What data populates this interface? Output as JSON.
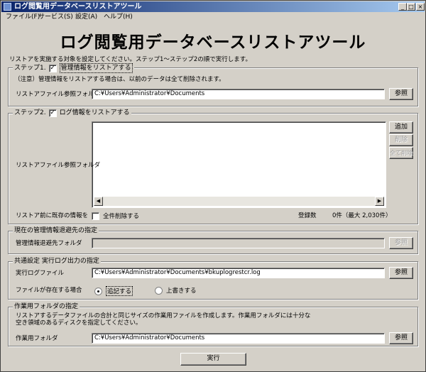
{
  "window": {
    "title": "ログ閲覧用データベースリストアツール"
  },
  "menu": [
    "ファイル(F)",
    "サービス(S)",
    "設定(A)",
    "ヘルプ(H)"
  ],
  "header": {
    "title": "ログ閲覧用データベースリストアツール",
    "intro": "リストアを実施する対象を設定してください。ステップ1～ステップ2の順で実行します。"
  },
  "step1": {
    "legend": "ステップ1.",
    "checkbox_label": "管理情報をリストアする",
    "checked": true,
    "note": "（注意）管理情報をリストアする場合は、以前のデータは全て削除されます。",
    "folder_label": "リストアファイル参照フォルダ",
    "folder_value": "C:¥Users¥Administrator¥Documents",
    "browse_label": "参照"
  },
  "step2": {
    "legend": "ステップ2.",
    "checkbox_label": "ログ情報をリストアする",
    "checked": true,
    "folder_label": "リストアファイル参照フォルダ",
    "add_label": "追加",
    "delete_label": "削除",
    "delete_all_label": "全て削除",
    "existing_label": "リストア前に既存の情報を",
    "delete_all_check_label": "全件削除する",
    "count_label": "登録数",
    "count_value": "0件（最大 2,030件）"
  },
  "evacuation": {
    "legend": "現在の管理情報退避先の指定",
    "folder_label": "管理情報退避先フォルダ",
    "folder_value": "",
    "browse_label": "参照"
  },
  "common": {
    "legend": "共通設定 実行ログ出力の指定",
    "log_label": "実行ログファイル",
    "log_value": "C:¥Users¥Administrator¥Documents¥bkuplogrestcr.log",
    "browse_label": "参照",
    "exists_label": "ファイルが存在する場合",
    "append_label": "追記する",
    "overwrite_label": "上書きする"
  },
  "work": {
    "legend": "作業用フォルダの指定",
    "description_line1": "リストアするデータファイルの合計と同じサイズの作業用ファイルを作成します。作業用フォルダには十分な",
    "description_line2": "空き領域のあるディスクを指定してください。",
    "folder_label": "作業用フォルダ",
    "folder_value": "C:¥Users¥Administrator¥Documents",
    "browse_label": "参照"
  },
  "run_label": "実行"
}
